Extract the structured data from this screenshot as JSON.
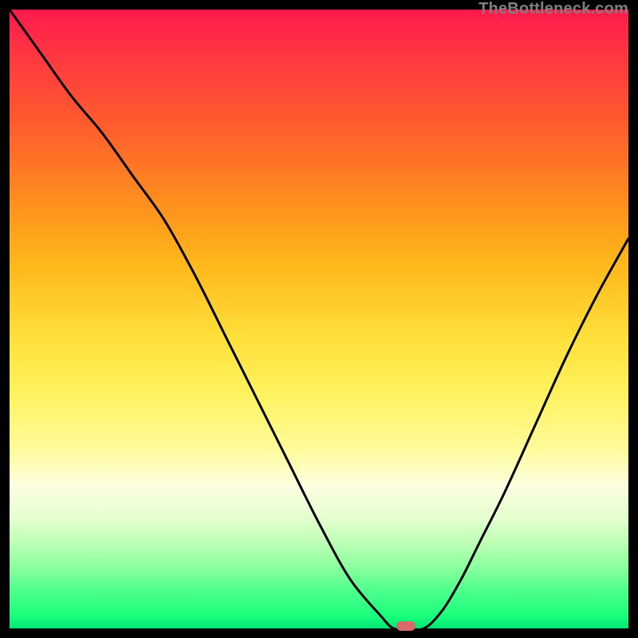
{
  "watermark": "TheBottleneck.com",
  "colors": {
    "frame_bg": "#000000",
    "curve": "#000000",
    "marker": "#d86a67"
  },
  "chart_data": {
    "type": "line",
    "title": "",
    "xlabel": "",
    "ylabel": "",
    "xlim": [
      0,
      100
    ],
    "ylim": [
      0,
      100
    ],
    "x": [
      0,
      5,
      10,
      15,
      20,
      25,
      30,
      35,
      40,
      45,
      50,
      55,
      60,
      62,
      64,
      67,
      70,
      73,
      76,
      80,
      85,
      90,
      95,
      100
    ],
    "values": [
      100,
      93,
      86,
      80,
      73,
      66,
      57,
      47,
      37,
      27,
      17,
      8,
      2,
      0,
      0,
      0,
      3,
      8,
      14,
      22,
      33,
      44,
      54,
      63
    ],
    "marker": {
      "x": 64,
      "y": 0
    }
  }
}
